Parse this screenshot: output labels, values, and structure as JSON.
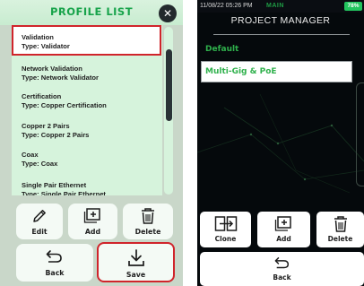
{
  "left_screen": {
    "title": "PROFILE LIST",
    "close_glyph": "✕",
    "profiles": [
      {
        "name": "Validation",
        "type": "Type: Validator",
        "selected": true
      },
      {
        "name": "Network Validation",
        "type": "Type: Network Validator",
        "selected": false
      },
      {
        "name": "Certification",
        "type": "Type: Copper Certification",
        "selected": false
      },
      {
        "name": "Copper 2 Pairs",
        "type": "Type: Copper 2 Pairs",
        "selected": false
      },
      {
        "name": "Coax",
        "type": "Type: Coax",
        "selected": false
      },
      {
        "name": "Single Pair Ethernet",
        "type": "Type: Single Pair Ethernet",
        "selected": false
      }
    ],
    "buttons": {
      "edit": {
        "label": "Edit",
        "icon": "pencil-icon"
      },
      "add": {
        "label": "Add",
        "icon": "add-box-icon"
      },
      "delete": {
        "label": "Delete",
        "icon": "trash-icon"
      },
      "back": {
        "label": "Back",
        "icon": "back-arrow-icon"
      },
      "save": {
        "label": "Save",
        "icon": "download-icon",
        "highlighted": true
      }
    },
    "highlight_color": "#d0242b",
    "title_color": "#17a34a"
  },
  "right_screen": {
    "status": {
      "datetime": "11/08/22 05:26 PM",
      "mode": "MAIN",
      "battery": "78%"
    },
    "header": "PROJECT MANAGER",
    "group_label": "Default",
    "project_name": "Multi-Gig & PoE",
    "buttons": {
      "clone": {
        "label": "Clone",
        "icon": "clone-icon"
      },
      "add": {
        "label": "Add",
        "icon": "add-box-icon"
      },
      "delete": {
        "label": "Delete",
        "icon": "trash-icon"
      },
      "back": {
        "label": "Back",
        "icon": "back-arrow-icon"
      }
    },
    "accent_color": "#2fb14c"
  }
}
